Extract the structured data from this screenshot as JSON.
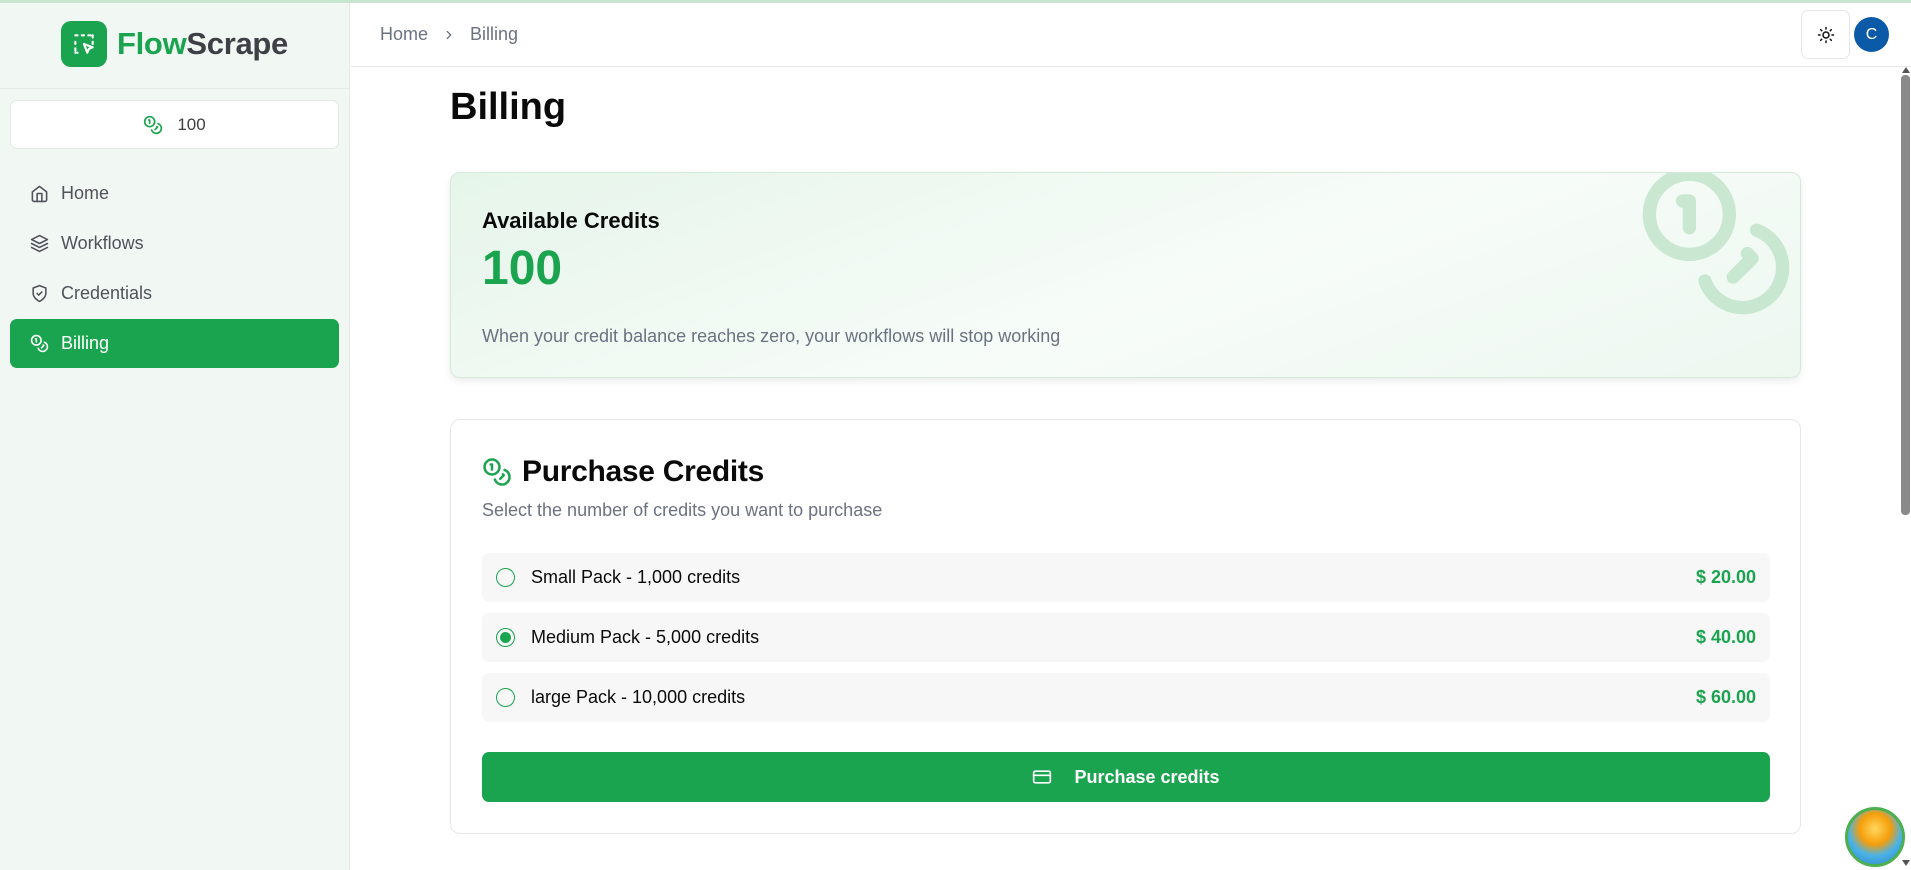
{
  "app": {
    "brand_part1": "Flow",
    "brand_part2": "Scrape",
    "accent_color": "#1ba44f"
  },
  "sidebar": {
    "credits_value": "100",
    "items": [
      {
        "label": "Home",
        "icon": "home-icon",
        "active": false
      },
      {
        "label": "Workflows",
        "icon": "layers-icon",
        "active": false
      },
      {
        "label": "Credentials",
        "icon": "shield-check-icon",
        "active": false
      },
      {
        "label": "Billing",
        "icon": "coins-icon",
        "active": true
      }
    ]
  },
  "header": {
    "breadcrumbs": [
      "Home",
      "Billing"
    ],
    "theme_icon": "sun-icon",
    "avatar_initial": "C"
  },
  "main": {
    "page_title": "Billing",
    "available": {
      "title": "Available Credits",
      "value": "100",
      "note": "When your credit balance reaches zero, your workflows will stop working"
    },
    "purchase": {
      "title": "Purchase Credits",
      "subtitle": "Select the number of credits you want to purchase",
      "options": [
        {
          "label": "Small Pack - 1,000 credits",
          "price": "$ 20.00",
          "selected": false
        },
        {
          "label": "Medium Pack - 5,000 credits",
          "price": "$ 40.00",
          "selected": true
        },
        {
          "label": "large Pack - 10,000 credits",
          "price": "$ 60.00",
          "selected": false
        }
      ],
      "button_label": "Purchase credits",
      "button_icon": "credit-card-icon"
    }
  }
}
